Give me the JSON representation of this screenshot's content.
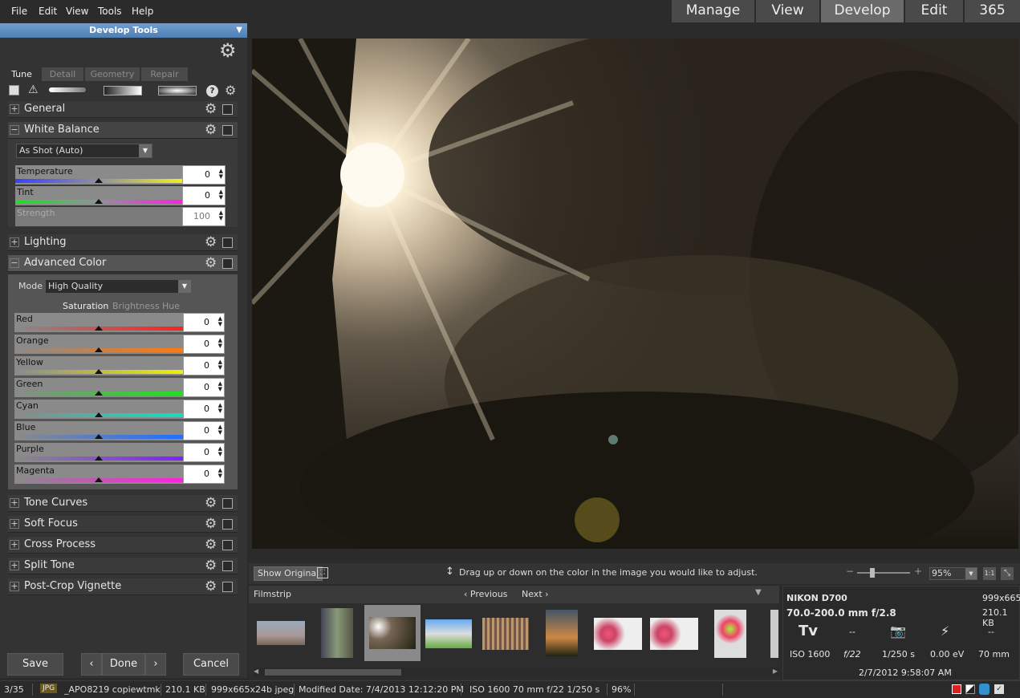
{
  "menu": [
    "File",
    "Edit",
    "View",
    "Tools",
    "Help"
  ],
  "modes": [
    {
      "label": "Manage",
      "active": false
    },
    {
      "label": "View",
      "active": false
    },
    {
      "label": "Develop",
      "active": true
    },
    {
      "label": "Edit",
      "active": false
    },
    {
      "label": "365",
      "active": false
    }
  ],
  "panel": {
    "header": "Develop Tools",
    "tabs": [
      "Tune",
      "Detail",
      "Geometry",
      "Repair"
    ],
    "sections": {
      "general": "General",
      "white_balance": "White Balance",
      "lighting": "Lighting",
      "advanced_color": "Advanced Color",
      "tone_curves": "Tone Curves",
      "soft_focus": "Soft Focus",
      "cross_process": "Cross Process",
      "split_tone": "Split Tone",
      "post_crop_vignette": "Post-Crop Vignette"
    },
    "white_balance": {
      "preset": "As Shot (Auto)",
      "temperature": {
        "label": "Temperature",
        "value": "0"
      },
      "tint": {
        "label": "Tint",
        "value": "0"
      },
      "strength": {
        "label": "Strength",
        "value": "100"
      }
    },
    "advanced_color": {
      "mode_label": "Mode",
      "mode_value": "High Quality",
      "tabs": [
        "Saturation",
        "Brightness",
        "Hue"
      ],
      "sliders": [
        {
          "label": "Red",
          "value": "0",
          "color": "#ff2020"
        },
        {
          "label": "Orange",
          "value": "0",
          "color": "#ff7a10"
        },
        {
          "label": "Yellow",
          "value": "0",
          "color": "#f0f000"
        },
        {
          "label": "Green",
          "value": "0",
          "color": "#20e020"
        },
        {
          "label": "Cyan",
          "value": "0",
          "color": "#10e0c0"
        },
        {
          "label": "Blue",
          "value": "0",
          "color": "#2070ff"
        },
        {
          "label": "Purple",
          "value": "0",
          "color": "#8020ff"
        },
        {
          "label": "Magenta",
          "value": "0",
          "color": "#ff20e0"
        }
      ]
    },
    "buttons": {
      "save": "Save",
      "done": "Done",
      "cancel": "Cancel"
    }
  },
  "viewer": {
    "show_original": "Show Original",
    "hint": "Drag up or down on the color in the image you would like to adjust.",
    "zoom": "95%"
  },
  "filmstrip": {
    "title": "Filmstrip",
    "previous": "Previous",
    "next": "Next"
  },
  "info": {
    "camera": "NIKON D700",
    "dimensions": "999x665",
    "lens": "70.0-200.0 mm f/2.8",
    "size": "210.1 KB",
    "mode": "Tv",
    "val1": "--",
    "val2": "--",
    "iso": "ISO 1600",
    "aperture": "f/22",
    "shutter": "1/250 s",
    "ev": "0.00 eV",
    "focal": "70 mm",
    "date": "2/7/2012 9:58:07 AM"
  },
  "status": {
    "count": "3/35",
    "type": "JPG",
    "filename": "_APO8219 copiewtmk",
    "size": "210.1 KB",
    "dims": "999x665x24b jpeg",
    "modified": "Modified Date: 7/4/2013 12:12:20 PM",
    "exif": "ISO 1600   70 mm   f/22   1/250 s",
    "zoom": "96%"
  }
}
